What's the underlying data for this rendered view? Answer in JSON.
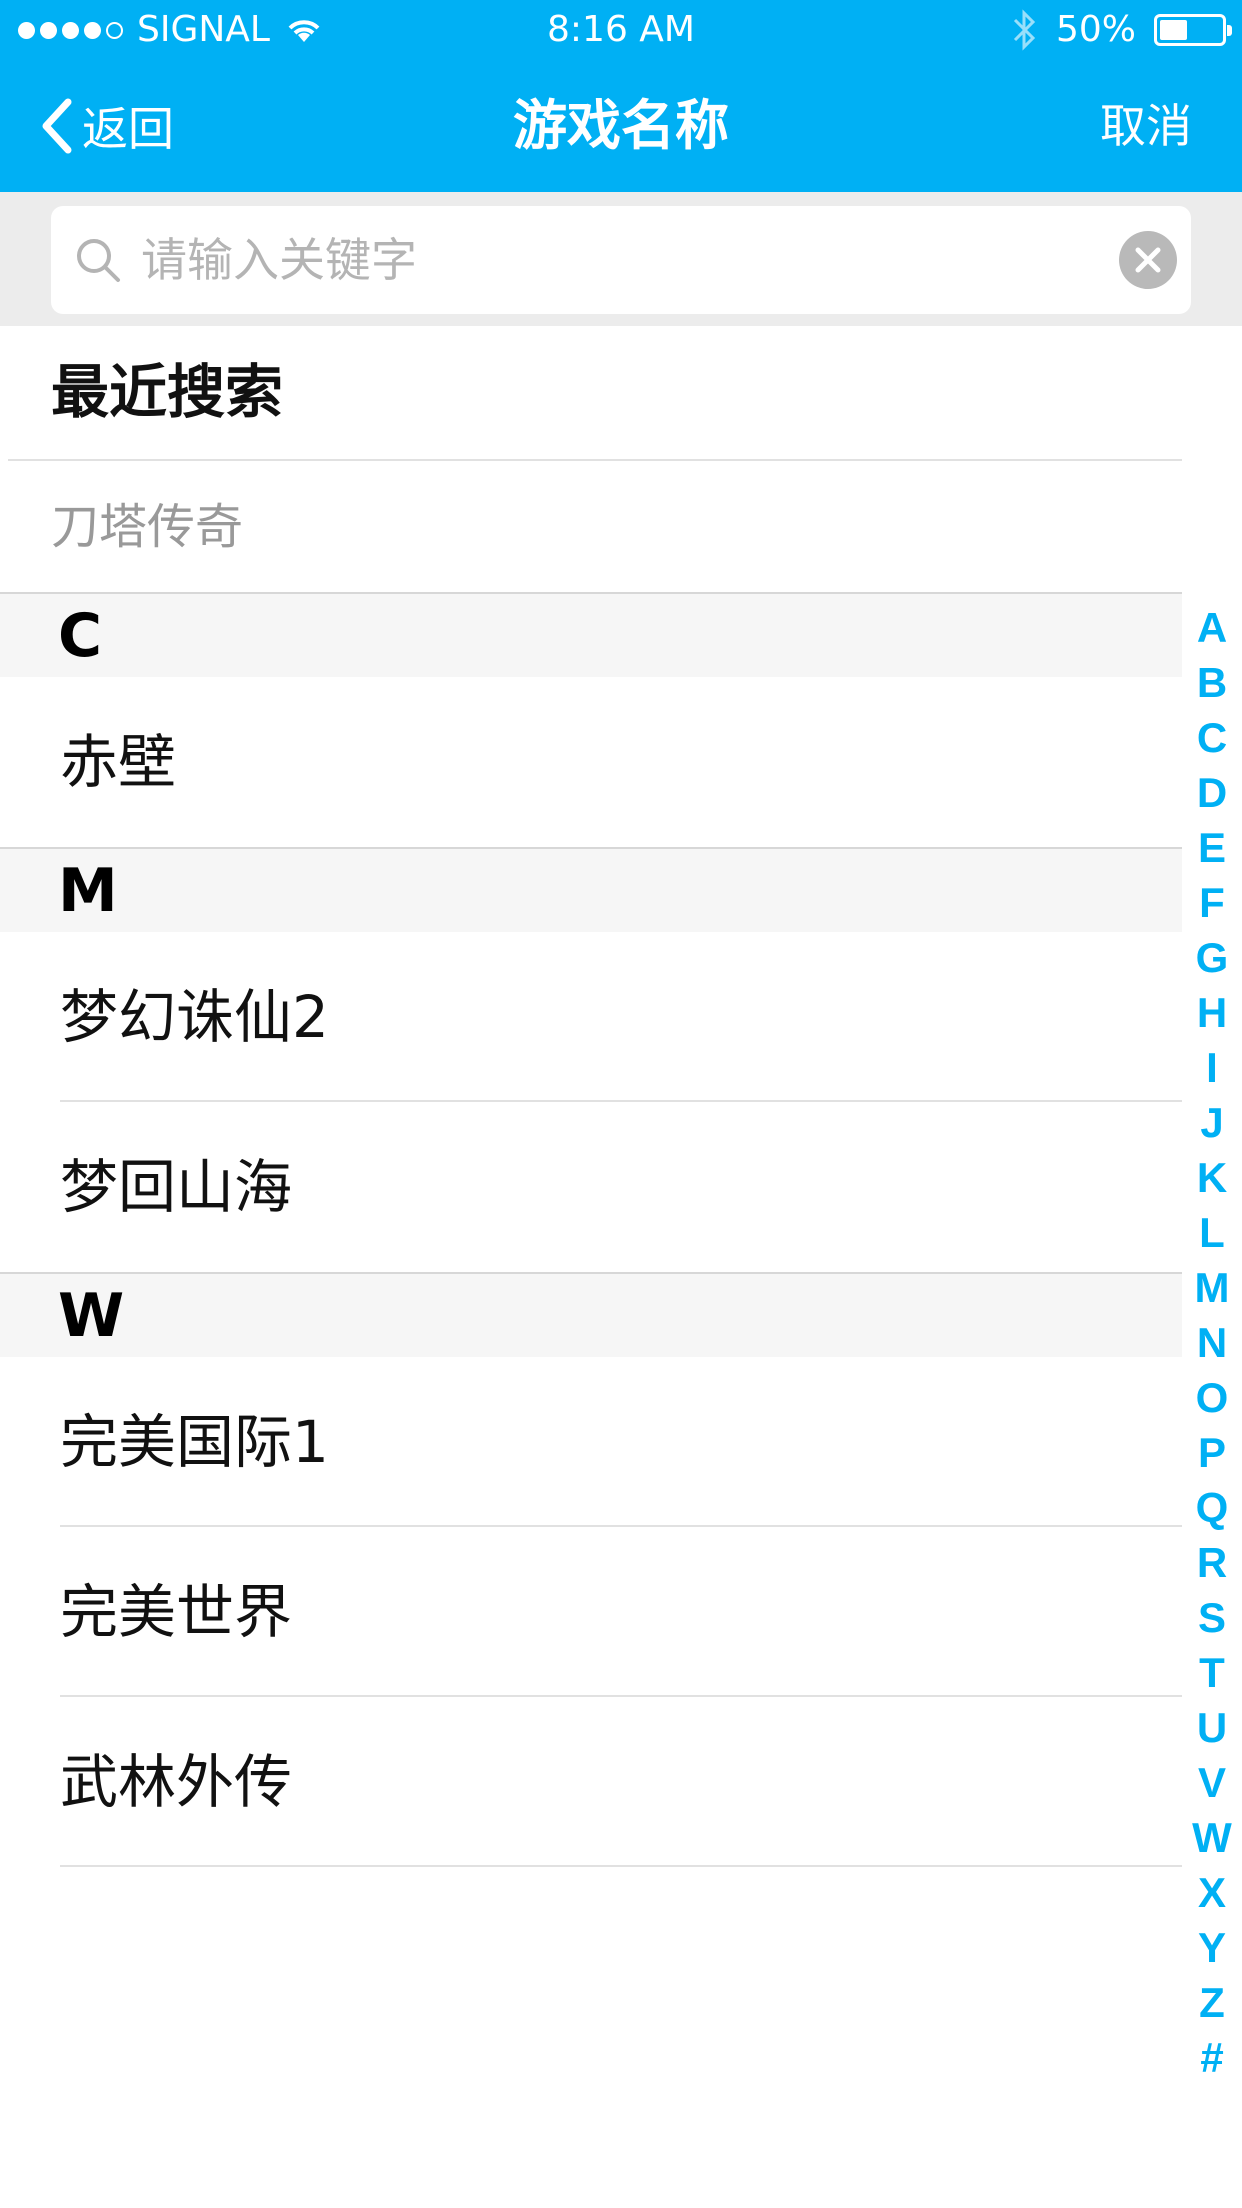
{
  "status_bar": {
    "carrier": "SIGNAL",
    "time": "8:16 AM",
    "battery": "50%",
    "battery_level": 0.5,
    "icons": [
      "signal-dots-icon",
      "wifi-icon",
      "bluetooth-icon",
      "battery-icon"
    ]
  },
  "nav": {
    "back_label": "返回",
    "title": "游戏名称",
    "cancel_label": "取消"
  },
  "search": {
    "placeholder": "请输入关键字",
    "value": ""
  },
  "recent": {
    "title": "最近搜索",
    "items": [
      "刀塔传奇"
    ]
  },
  "sections": [
    {
      "letter": "C",
      "items": [
        "赤壁"
      ]
    },
    {
      "letter": "M",
      "items": [
        "梦幻诛仙2",
        "梦回山海"
      ]
    },
    {
      "letter": "W",
      "items": [
        "完美国际1",
        "完美世界",
        "武林外传"
      ]
    }
  ],
  "index_letters": [
    "A",
    "B",
    "C",
    "D",
    "E",
    "F",
    "G",
    "H",
    "I",
    "J",
    "K",
    "L",
    "M",
    "N",
    "O",
    "P",
    "Q",
    "R",
    "S",
    "T",
    "U",
    "V",
    "W",
    "X",
    "Y",
    "Z",
    "#"
  ],
  "colors": {
    "accent": "#00b0f4",
    "section_bg": "#f6f6f6",
    "search_bg": "#ececec"
  }
}
